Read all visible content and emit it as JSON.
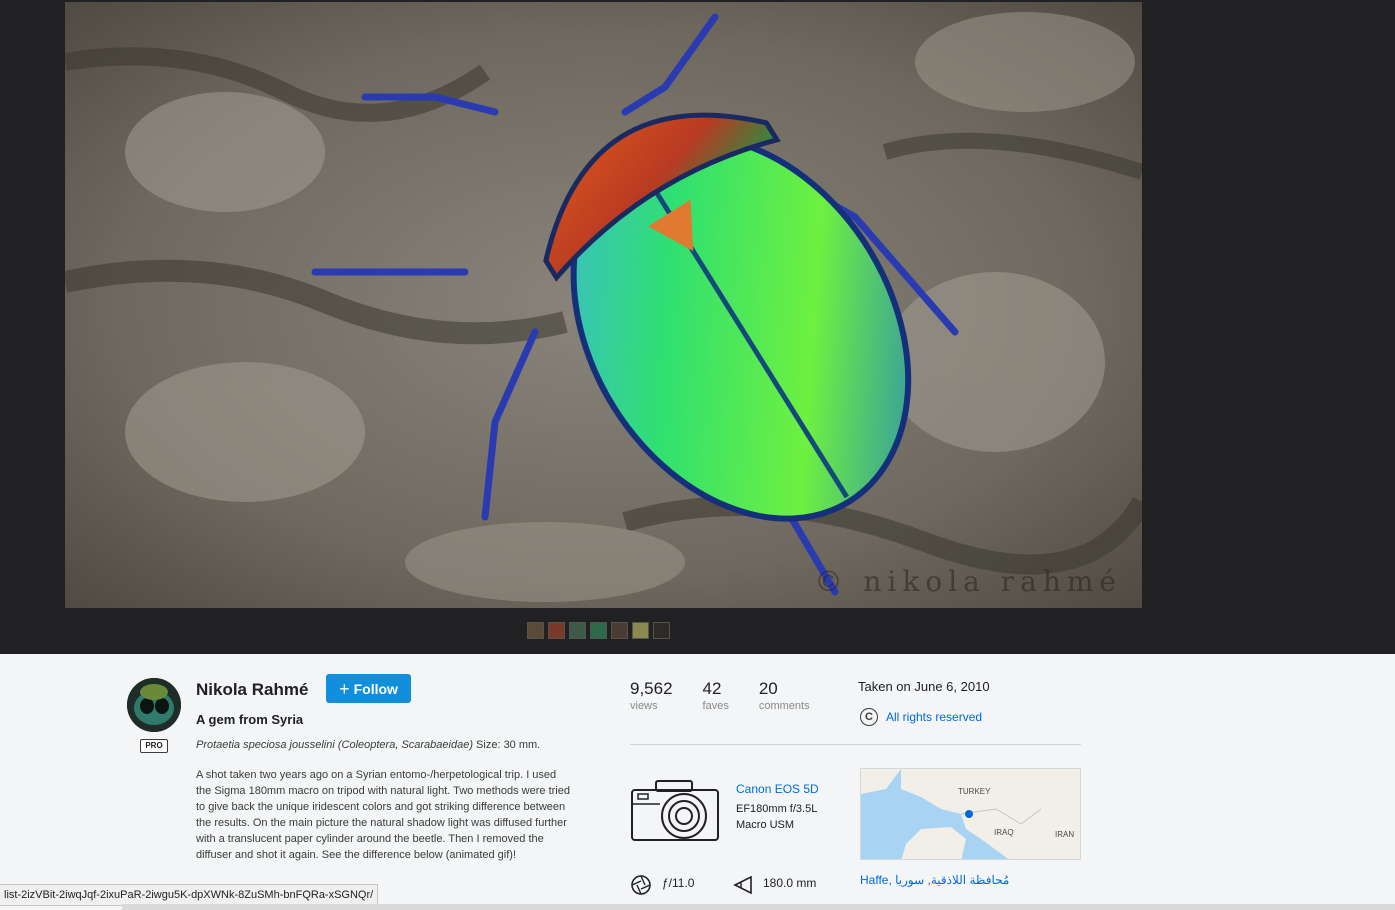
{
  "photo": {
    "watermark": "© nikola rahmé",
    "thumbnail_colors": [
      "#5a4a38",
      "#7a3a2a",
      "#3e5a48",
      "#2c6a4a",
      "#4a3c30",
      "#8a8a50",
      "#2e2a26"
    ]
  },
  "author": {
    "name": "Nikola Rahmé",
    "badge": "PRO",
    "follow_label": "Follow"
  },
  "photo_title": "A gem from Syria",
  "description": {
    "species": "Protaetia speciosa jousselini (Coleoptera, Scarabaeidae)",
    "species_suffix": " Size: 30 mm.",
    "body": "A shot taken two years ago on a Syrian entomo-/herpetological trip. I used the Sigma 180mm macro on tripod with natural light. Two methods were tried to give back the unique iridescent colors and got striking difference between the results. On the main picture the natural shadow light was diffused further with a translucent paper cylinder around the beetle. Then I removed the diffuser and shot it again. See the difference below (animated gif)!"
  },
  "stats": [
    {
      "value": "9,562",
      "label": "views"
    },
    {
      "value": "42",
      "label": "faves"
    },
    {
      "value": "20",
      "label": "comments"
    }
  ],
  "taken": "Taken on June 6, 2010",
  "license": {
    "icon": "copyright-icon",
    "label": "All rights reserved"
  },
  "camera": {
    "name": "Canon EOS 5D",
    "lens": "EF180mm f/3.5L Macro USM"
  },
  "exif": {
    "aperture": "ƒ/11.0",
    "focal_length": "180.0 mm"
  },
  "map": {
    "labels": [
      "TURKEY",
      "IRAQ",
      "IRAN"
    ]
  },
  "location": "Haffe, مُحافظة اللاذقية, سوريا",
  "status_url": "list-2izVBit-2iwqJqf-2ixuPaR-2iwgu5K-dpXWNk-8ZuSMh-bnFQRa-xSGNQr/",
  "colors": {
    "accent": "#128fdc",
    "link": "#006add",
    "stage": "#212124"
  }
}
